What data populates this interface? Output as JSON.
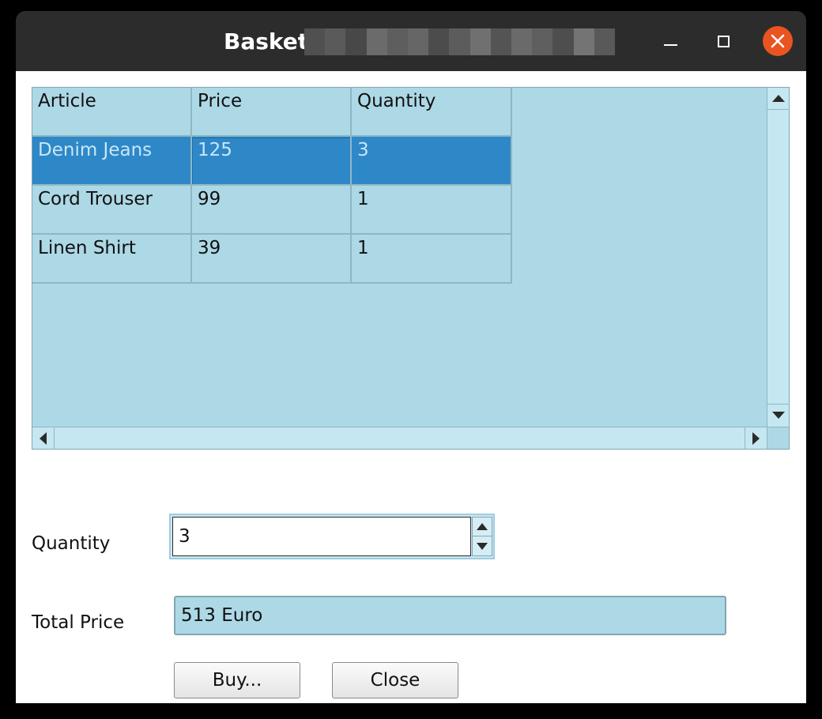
{
  "window": {
    "title": "Basket",
    "title_blur_colors": [
      "#505050",
      "#5a5a5a",
      "#484848",
      "#6b6b6b",
      "#5e5e5e",
      "#666666",
      "#4c4c4c",
      "#5c5c5c",
      "#707070",
      "#545454",
      "#6a6a6a",
      "#5f5f5f",
      "#4e4e4e",
      "#747474",
      "#595959"
    ]
  },
  "table": {
    "headers": [
      "Article",
      "Price",
      "Quantity"
    ],
    "rows": [
      [
        "Denim Jeans",
        "125",
        "3"
      ],
      [
        "Cord Trouser",
        "99",
        "1"
      ],
      [
        "Linen Shirt",
        "39",
        "1"
      ]
    ],
    "selected_row": 0
  },
  "form": {
    "quantity_label": "Quantity",
    "quantity_value": "3",
    "total_label": "Total Price",
    "total_value": "513 Euro"
  },
  "buttons": {
    "buy_label": "Buy...",
    "close_label": "Close"
  },
  "colors": {
    "table_bg": "#add8e6",
    "selection": "#2e88c8",
    "close_button": "#e95420",
    "titlebar": "#2c2c2c"
  }
}
